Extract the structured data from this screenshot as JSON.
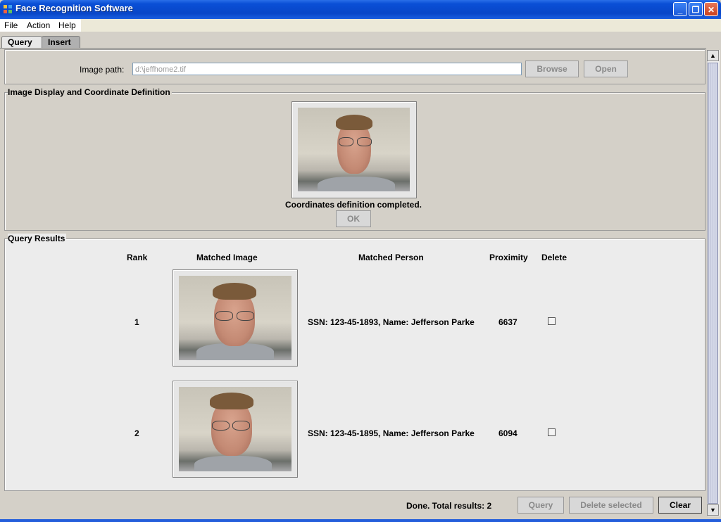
{
  "window": {
    "title": "Face Recognition Software"
  },
  "menu": [
    "File",
    "Action",
    "Help"
  ],
  "tabs": {
    "query": "Query",
    "insert": "Insert"
  },
  "image_path": {
    "label": "Image path:",
    "value": "d:\\jeffhome2.tif",
    "browse": "Browse",
    "open": "Open"
  },
  "display_panel": {
    "legend": "Image Display and Coordinate Definition",
    "status": "Coordinates definition completed.",
    "ok": "OK"
  },
  "results_panel": {
    "legend": "Query Results",
    "headers": {
      "rank": "Rank",
      "image": "Matched Image",
      "person": "Matched Person",
      "proximity": "Proximity",
      "delete": "Delete"
    },
    "rows": [
      {
        "rank": "1",
        "person": "SSN: 123-45-1893, Name: Jefferson Parke",
        "proximity": "6637",
        "delete": false
      },
      {
        "rank": "2",
        "person": "SSN: 123-45-1895, Name: Jefferson Parke",
        "proximity": "6094",
        "delete": false
      }
    ]
  },
  "footer": {
    "status": "Done.  Total results: 2",
    "query": "Query",
    "delete_selected": "Delete selected",
    "clear": "Clear"
  },
  "icons": [
    "app-icon",
    "minimize-icon",
    "restore-icon",
    "close-icon",
    "scroll-up-icon",
    "scroll-down-icon"
  ]
}
